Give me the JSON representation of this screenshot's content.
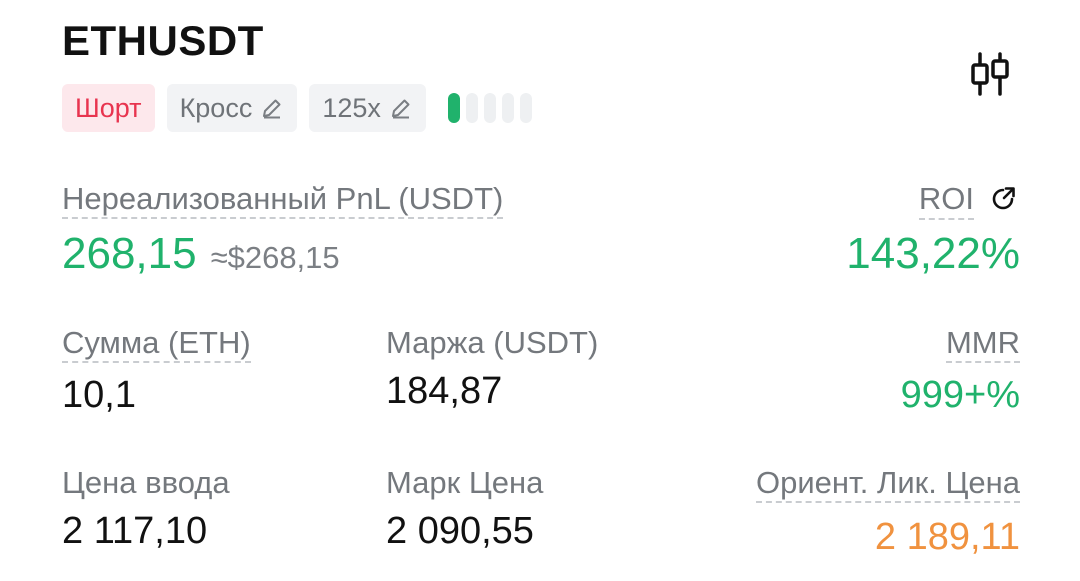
{
  "header": {
    "symbol": "ETHUSDT",
    "chart_icon": "candlestick-chart-icon"
  },
  "tags": {
    "side": "Шорт",
    "margin_mode": "Кросс",
    "leverage": "125x",
    "edit_icon": "pencil-icon",
    "risk_level": 1,
    "risk_levels_total": 5
  },
  "pnl": {
    "label": "Нереализованный PnL (USDT)",
    "value": "268,15",
    "usd_equiv": "≈$268,15"
  },
  "roi": {
    "label": "ROI",
    "value": "143,22%",
    "share_icon": "share-arrow-icon"
  },
  "fields": {
    "amount": {
      "label": "Сумма (ETH)",
      "value": "10,1"
    },
    "margin": {
      "label": "Маржа (USDT)",
      "value": "184,87"
    },
    "mmr": {
      "label": "MMR",
      "value": "999+%"
    },
    "entry_price": {
      "label": "Цена ввода",
      "value": "2 117,10"
    },
    "mark_price": {
      "label": "Марк Цена",
      "value": "2 090,55"
    },
    "liq_price": {
      "label": "Ориент. Лик. Цена",
      "value": "2 189,11"
    }
  },
  "colors": {
    "green": "#20b26c",
    "short_red": "#e8344f",
    "liq_orange": "#f0923f",
    "label_gray": "#74787d"
  }
}
